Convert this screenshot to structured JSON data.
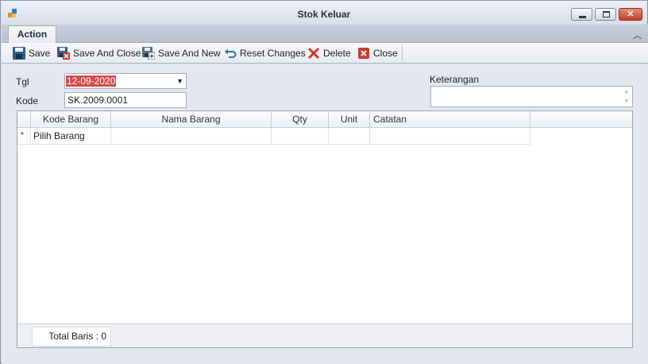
{
  "window": {
    "title": "Stok Keluar"
  },
  "ribbon": {
    "tab_label": "Action"
  },
  "toolbar": {
    "save": "Save",
    "save_and_close": "Save And Close",
    "save_and_new": "Save And New",
    "reset_changes": "Reset Changes",
    "delete": "Delete",
    "close": "Close"
  },
  "form": {
    "tgl_label": "Tgl",
    "tgl_value": "12-09-2020",
    "kode_label": "Kode",
    "kode_value": "SK.2009.0001",
    "keterangan_label": "Keterangan",
    "keterangan_value": ""
  },
  "grid": {
    "columns": [
      "Kode Barang",
      "Nama Barang",
      "Qty",
      "Unit",
      "Catatan"
    ],
    "new_row_indicator": "*",
    "new_row_placeholder": "Pilih Barang",
    "footer_total": "Total Baris : 0"
  },
  "colors": {
    "accent_selection": "#d64a4a",
    "close_button": "#c2402c"
  },
  "icons": [
    "app-icon",
    "minimize-icon",
    "maximize-icon",
    "close-window-icon",
    "collapse-ribbon-icon",
    "save-icon",
    "save-and-close-icon",
    "save-and-new-icon",
    "reset-icon",
    "delete-icon",
    "close-icon",
    "dropdown-arrow-icon"
  ]
}
